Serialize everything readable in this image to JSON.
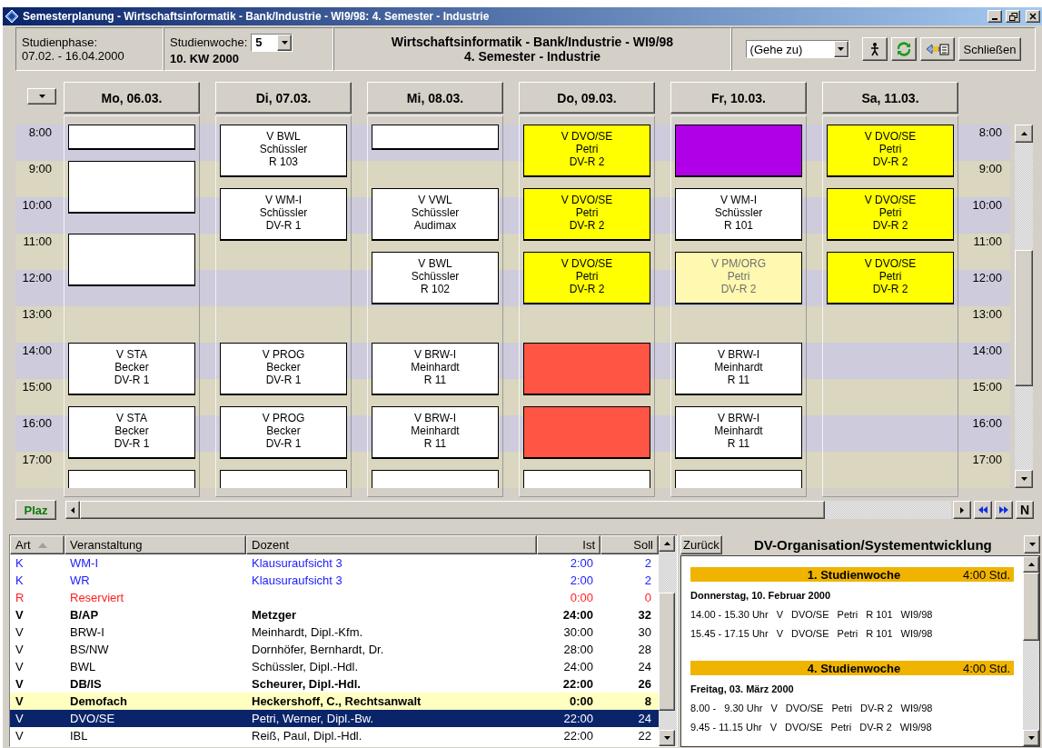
{
  "window": {
    "title": "Semesterplanung - Wirtschaftsinformatik - Bank/Industrie - WI9/98: 4. Semester - Industrie"
  },
  "toolbar": {
    "phase_label": "Studienphase:",
    "phase_value": "07.02. - 16.04.2000",
    "week_label": "Studienwoche:",
    "week_select": "5",
    "week_value": "10. KW 2000",
    "heading": [
      "Wirtschaftsinformatik - Bank/Industrie - WI9/98",
      "4. Semester - Industrie"
    ],
    "goto": "(Gehe zu)",
    "close_button": "Schließen"
  },
  "calendar": {
    "hours_left": [
      "8:00",
      "9:00",
      "10:00",
      "11:00",
      "12:00",
      "13:00",
      "14:00",
      "15:00",
      "16:00",
      "17:00"
    ],
    "hours_right": [
      "8:00",
      "9:00",
      "10:00",
      "11:00",
      "12:00",
      "13:00",
      "14:00",
      "15:00",
      "16:00",
      "17:00"
    ],
    "days": [
      {
        "label": "Mo, 06.03.",
        "events": [
          {
            "kind": "first-short",
            "color": "#ffffff"
          },
          {
            "kind": "second-early",
            "color": "#ffffff"
          },
          {
            "kind": "third-early",
            "color": "#ffffff"
          },
          {
            "kind": "fourth",
            "color": "#ffffff",
            "dimmed": false,
            "lines": [
              "V STA",
              "Becker",
              "DV-R 1"
            ]
          },
          {
            "kind": "fifth",
            "color": "#ffffff",
            "dimmed": false,
            "lines": [
              "V STA",
              "Becker",
              "DV-R 1"
            ]
          },
          {
            "kind": "sixth",
            "color": "#ffffff"
          }
        ]
      },
      {
        "label": "Di, 07.03.",
        "events": [
          {
            "kind": "first",
            "color": "#ffffff",
            "dimmed": false,
            "lines": [
              "V BWL",
              "Schüssler",
              "R 103"
            ]
          },
          {
            "kind": "second",
            "color": "#ffffff",
            "dimmed": false,
            "lines": [
              "V WM-I",
              "Schüssler",
              "DV-R 1"
            ]
          },
          {
            "kind": "fourth",
            "color": "#ffffff",
            "dimmed": false,
            "lines": [
              "V PROG",
              "Becker",
              "DV-R 1"
            ]
          },
          {
            "kind": "fifth",
            "color": "#ffffff",
            "dimmed": false,
            "lines": [
              "V PROG",
              "Becker",
              "DV-R 1"
            ]
          },
          {
            "kind": "sixth",
            "color": "#ffffff"
          }
        ]
      },
      {
        "label": "Mi, 08.03.",
        "events": [
          {
            "kind": "first-short",
            "color": "#ffffff"
          },
          {
            "kind": "second",
            "color": "#ffffff",
            "dimmed": false,
            "lines": [
              "V VWL",
              "Schüssler",
              "Audimax"
            ]
          },
          {
            "kind": "third",
            "color": "#ffffff",
            "dimmed": false,
            "lines": [
              "V BWL",
              "Schüssler",
              "R 102"
            ]
          },
          {
            "kind": "fourth",
            "color": "#ffffff",
            "dimmed": false,
            "lines": [
              "V BRW-I",
              "Meinhardt",
              "R 11"
            ]
          },
          {
            "kind": "fifth",
            "color": "#ffffff",
            "dimmed": false,
            "lines": [
              "V BRW-I",
              "Meinhardt",
              "R 11"
            ]
          },
          {
            "kind": "sixth",
            "color": "#ffffff"
          }
        ]
      },
      {
        "label": "Do, 09.03.",
        "events": [
          {
            "kind": "first",
            "color": "#ffff00",
            "dimmed": false,
            "lines": [
              "V DVO/SE",
              "Petri",
              "DV-R 2"
            ]
          },
          {
            "kind": "second",
            "color": "#ffff00",
            "dimmed": false,
            "lines": [
              "V DVO/SE",
              "Petri",
              "DV-R 2"
            ]
          },
          {
            "kind": "third",
            "color": "#ffff00",
            "dimmed": false,
            "lines": [
              "V DVO/SE",
              "Petri",
              "DV-R 2"
            ]
          },
          {
            "kind": "fourth",
            "color": "#ff5544"
          },
          {
            "kind": "fifth",
            "color": "#ff5544"
          },
          {
            "kind": "sixth",
            "color": "#ffffff"
          }
        ]
      },
      {
        "label": "Fr, 10.03.",
        "events": [
          {
            "kind": "first",
            "color": "#b000e8"
          },
          {
            "kind": "second",
            "color": "#ffffff",
            "dimmed": false,
            "lines": [
              "V WM-I",
              "Schüssler",
              "R 101"
            ]
          },
          {
            "kind": "third",
            "color": "#fff8b0",
            "dimmed": true,
            "lines": [
              "V PM/ORG",
              "Petri",
              "DV-R 2"
            ]
          },
          {
            "kind": "fourth",
            "color": "#ffffff",
            "dimmed": false,
            "lines": [
              "V BRW-I",
              "Meinhardt",
              "R 11"
            ]
          },
          {
            "kind": "fifth",
            "color": "#ffffff",
            "dimmed": false,
            "lines": [
              "V BRW-I",
              "Meinhardt",
              "R 11"
            ]
          },
          {
            "kind": "sixth",
            "color": "#ffffff"
          }
        ]
      },
      {
        "label": "Sa, 11.03.",
        "events": [
          {
            "kind": "first",
            "color": "#ffff00",
            "dimmed": false,
            "lines": [
              "V DVO/SE",
              "Petri",
              "DV-R 2"
            ]
          },
          {
            "kind": "second",
            "color": "#ffff00",
            "dimmed": false,
            "lines": [
              "V DVO/SE",
              "Petri",
              "DV-R 2"
            ]
          },
          {
            "kind": "third",
            "color": "#ffff00",
            "dimmed": false,
            "lines": [
              "V DVO/SE",
              "Petri",
              "DV-R 2"
            ]
          }
        ]
      }
    ],
    "plaz_button": "Plaz",
    "nav_button": "N"
  },
  "table": {
    "columns": [
      "Art",
      "Veranstaltung",
      "Dozent",
      "Ist",
      "Soll"
    ],
    "rows": [
      {
        "cells": [
          "K",
          "WM-I",
          "Klausuraufsicht 3",
          "2:00",
          "2"
        ],
        "color": "#2020ff",
        "bold": false,
        "highlighted": false,
        "selected": false
      },
      {
        "cells": [
          "K",
          "WR",
          "Klausuraufsicht 3",
          "2:00",
          "2"
        ],
        "color": "#2020ff",
        "bold": false,
        "highlighted": false,
        "selected": false
      },
      {
        "cells": [
          "R",
          "Reserviert",
          "",
          "0:00",
          "0"
        ],
        "color": "#ff2020",
        "bold": false,
        "highlighted": false,
        "selected": false
      },
      {
        "cells": [
          "V",
          "B/AP",
          "Metzger",
          "24:00",
          "32"
        ],
        "color": "#000000",
        "bold": true,
        "highlighted": false,
        "selected": false
      },
      {
        "cells": [
          "V",
          "BRW-I",
          "Meinhardt, Dipl.-Kfm.",
          "30:00",
          "30"
        ],
        "color": "#000000",
        "bold": false,
        "highlighted": false,
        "selected": false
      },
      {
        "cells": [
          "V",
          "BS/NW",
          "Dornhöfer, Bernhardt, Dr.",
          "28:00",
          "28"
        ],
        "color": "#000000",
        "bold": false,
        "highlighted": false,
        "selected": false
      },
      {
        "cells": [
          "V",
          "BWL",
          "Schüssler, Dipl.-Hdl.",
          "24:00",
          "24"
        ],
        "color": "#000000",
        "bold": false,
        "highlighted": false,
        "selected": false
      },
      {
        "cells": [
          "V",
          "DB/IS",
          "Scheurer, Dipl.-Hdl.",
          "22:00",
          "26"
        ],
        "color": "#000000",
        "bold": true,
        "highlighted": false,
        "selected": false
      },
      {
        "cells": [
          "V",
          "Demofach",
          "Heckershoff, C., Rechtsanwalt",
          "0:00",
          "8"
        ],
        "color": "#000000",
        "bold": true,
        "highlighted": true,
        "selected": false
      },
      {
        "cells": [
          "V",
          "DVO/SE",
          "Petri, Werner, Dipl.-Bw.",
          "22:00",
          "24"
        ],
        "bold": false,
        "highlighted": false,
        "selected": true
      },
      {
        "cells": [
          "V",
          "IBL",
          "Reiß, Paul, Dipl.-Hdl.",
          "22:00",
          "22"
        ],
        "color": "#000000",
        "bold": false,
        "highlighted": false,
        "selected": false
      }
    ]
  },
  "detail": {
    "back_button": "Zurück",
    "title": "DV-Organisation/Systementwicklung",
    "weeks": [
      {
        "title": "1. Studienwoche",
        "hours": "4:00 Std.",
        "date": "Donnerstag, 10. Februar 2000",
        "lines": [
          [
            "14.00 - 15.30 Uhr",
            "V",
            "DVO/SE",
            "Petri",
            "R 101",
            "WI9/98"
          ],
          [
            "15.45 - 17.15 Uhr",
            "V",
            "DVO/SE",
            "Petri",
            "R 101",
            "WI9/98"
          ]
        ]
      },
      {
        "title": "4. Studienwoche",
        "hours": "4:00 Std.",
        "date": "Freitag, 03. März 2000",
        "lines": [
          [
            "8.00 -   9.30 Uhr",
            "V",
            "DVO/SE",
            "Petri",
            "DV-R 2",
            "WI9/98"
          ],
          [
            "9.45 - 11.15 Uhr",
            "V",
            "DVO/SE",
            "Petri",
            "DV-R 2",
            "WI9/98"
          ]
        ]
      }
    ]
  }
}
